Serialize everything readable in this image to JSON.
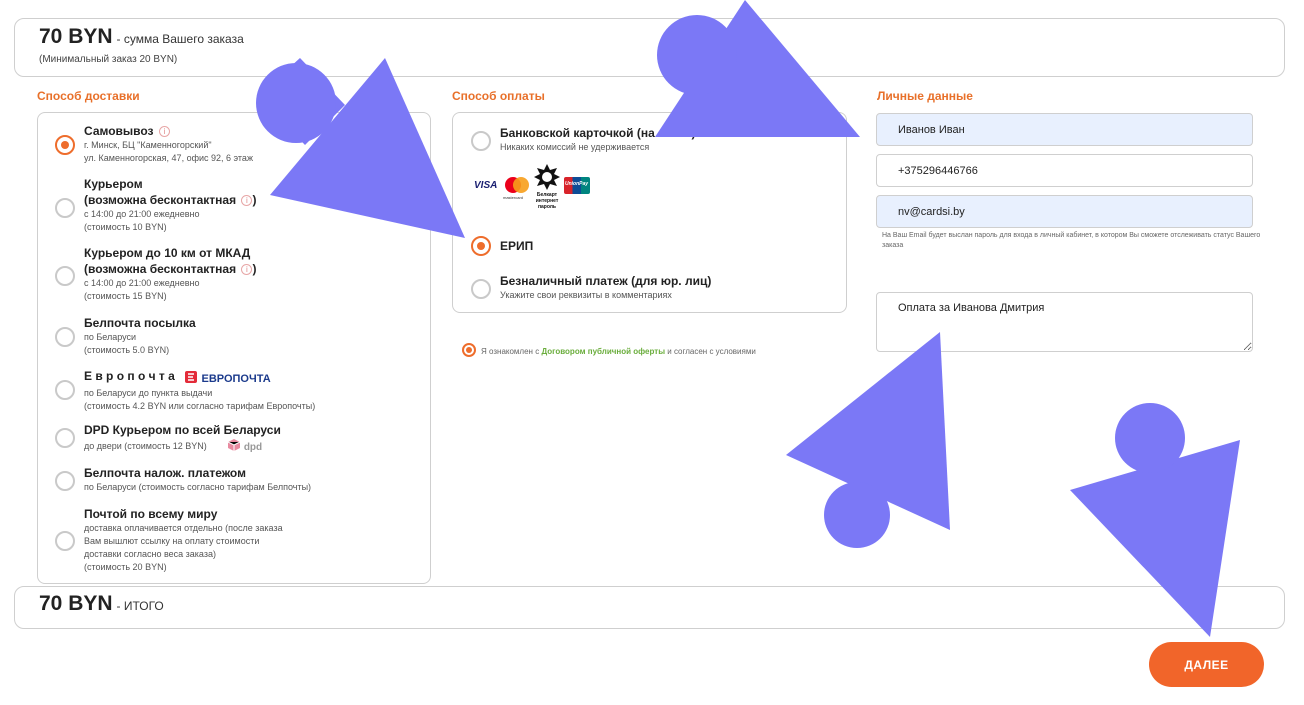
{
  "summary": {
    "amount": "70 BYN",
    "caption": "- сумма Вашего заказа",
    "min_order": "(Минимальный заказ 20 BYN)"
  },
  "delivery": {
    "title": "Способ доставки",
    "options": [
      {
        "title": "Самовывоз",
        "lines": [
          "г. Минск, БЦ \"Каменногорский\"",
          "ул. Каменногорская, 47, офис 92, 6 этаж"
        ],
        "checked": true
      },
      {
        "title": "Курьером",
        "title2": "(возможна бесконтактная",
        "title2_end": ")",
        "lines": [
          "с 14:00 до 21:00 ежедневно",
          "(стоимость 10 BYN)"
        ]
      },
      {
        "title": "Курьером до 10 км от МКАД",
        "title2": "(возможна бесконтактная",
        "title2_end": ")",
        "lines": [
          "с 14:00 до 21:00 ежедневно",
          "(стоимость 15 BYN)"
        ]
      },
      {
        "title": "Белпочта посылка",
        "lines": [
          "по Беларуси",
          "(стоимость 5.0 BYN)"
        ]
      },
      {
        "title": "Е в р о п о ч т а",
        "lines": [
          "по Беларуси до пункта выдачи",
          "(стоимость 4.2 BYN или согласно тарифам Европочты)"
        ],
        "logo": "ЕВРОПОЧТА"
      },
      {
        "title": "DPD Курьером по всей Беларуси",
        "lines": [
          "до двери (стоимость 12 BYN)"
        ],
        "logo": "dpd"
      },
      {
        "title": "Белпочта налож. платежом",
        "lines": [
          "по Беларуси (стоимость согласно тарифам Белпочты)"
        ]
      },
      {
        "title": "Почтой по всему миру",
        "lines": [
          "доставка оплачивается отдельно (после заказа",
          "Вам вышлют ссылку на оплату стоимости",
          "доставки согласно веса заказа)",
          "(стоимость 20 BYN)"
        ]
      }
    ]
  },
  "payment": {
    "title": "Способ оплаты",
    "options": [
      {
        "title": "Банковской карточкой (на сайте)",
        "sub": "Никаких комиссий не удерживается"
      },
      {
        "title": "ЕРИП",
        "checked": true
      },
      {
        "title": "Безналичный платеж (для юр. лиц)",
        "sub": "Укажите свои реквизиты в комментариях"
      }
    ],
    "logos": {
      "visa": "VISA",
      "mastercard": "mastercard",
      "belcart": "Белкарт интернет пароль",
      "unionpay": "UnionPay"
    },
    "agree_prefix": "Я ознакомлен с",
    "agree_link": "Договором публичной оферты",
    "agree_suffix": "и согласен с условиями"
  },
  "personal": {
    "title": "Личные данные",
    "name": "Иванов Иван",
    "phone": "+375296446766",
    "email": "nv@cardsi.by",
    "note": "На Ваш Email будет выслан пароль для входа в личный кабинет, в котором Вы сможете отслеживать статус Вашего заказа",
    "comment": "Оплата за Иванова Дмитрия"
  },
  "total": {
    "amount": "70 BYN",
    "caption": "- ИТОГО"
  },
  "next_label": "ДАЛЕЕ",
  "colors": {
    "accent": "#ee6d2c",
    "button": "#f1652a",
    "link": "#6aad3c",
    "arrow": "#7b78f6",
    "autofill": "#e8f0fe"
  }
}
